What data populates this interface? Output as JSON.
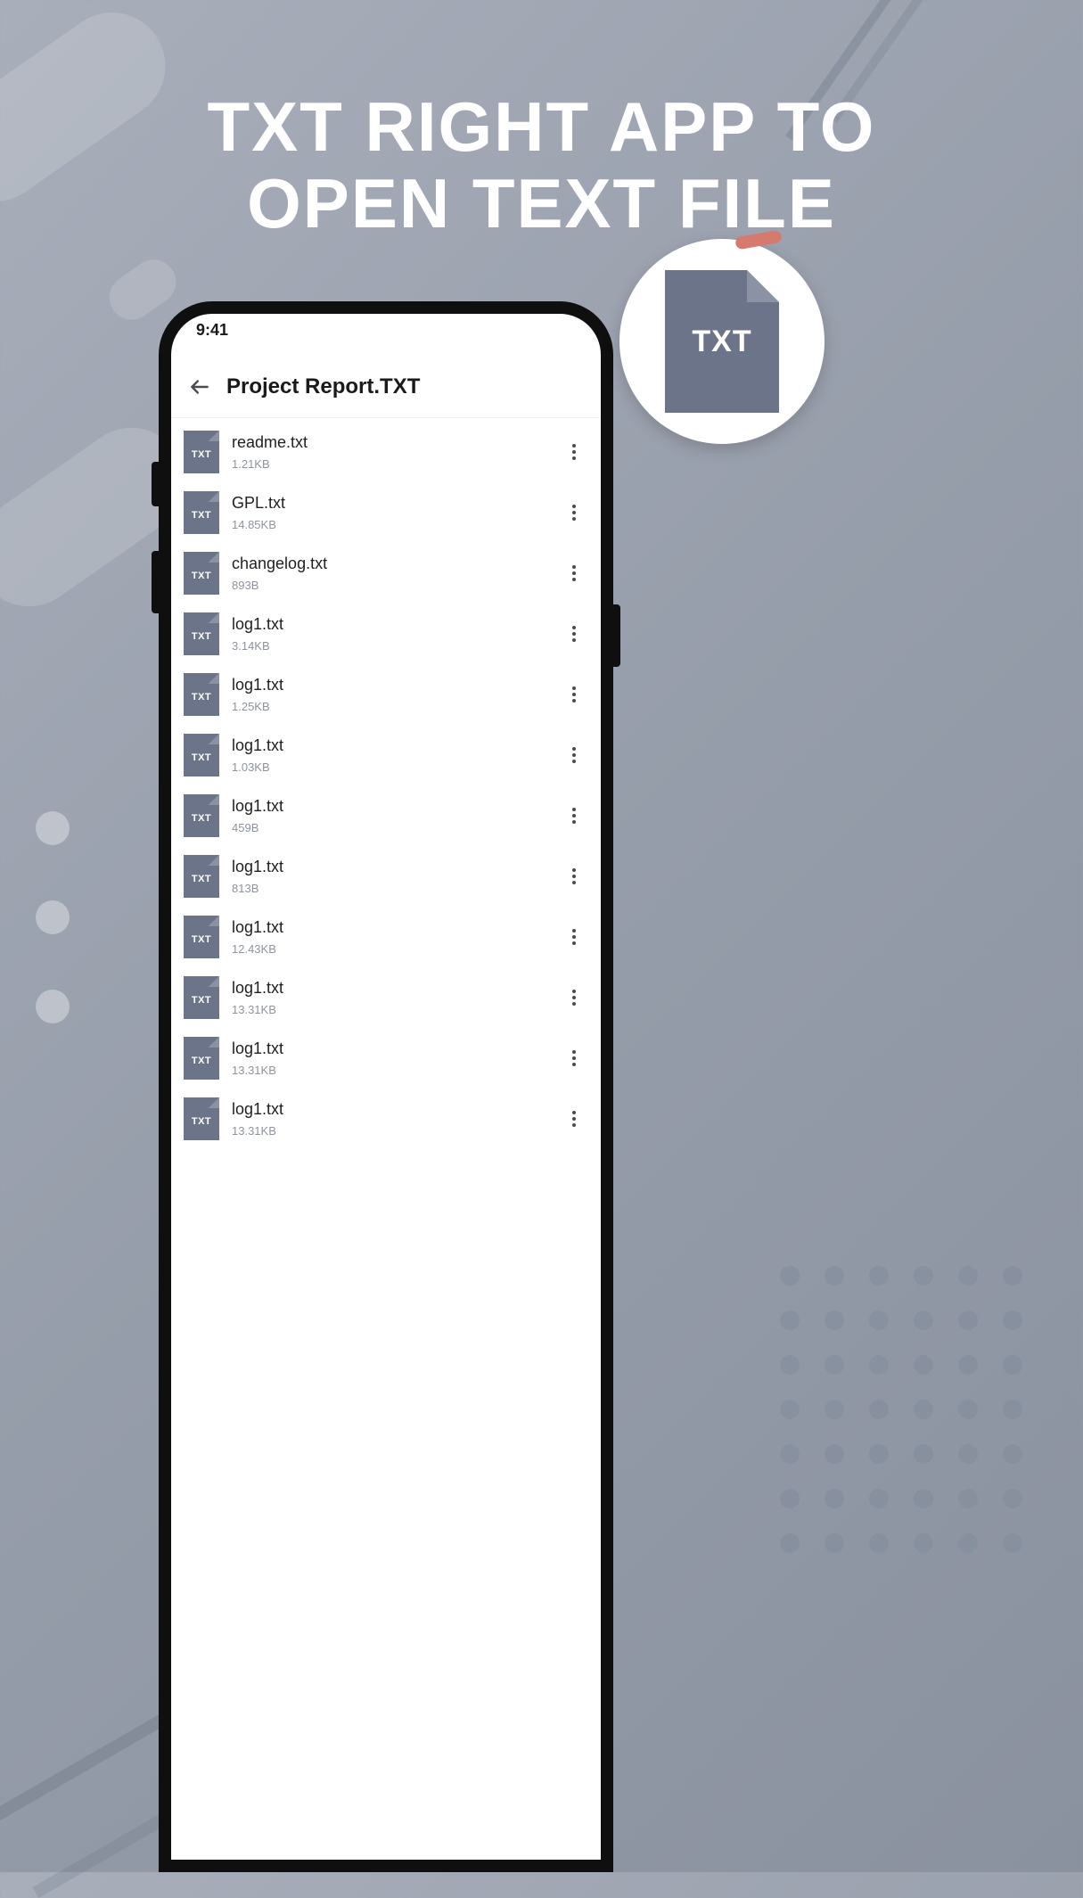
{
  "hero": {
    "line1": "TXT RIGHT APP TO",
    "line2": "OPEN TEXT FILE"
  },
  "statusBar": {
    "time": "9:41"
  },
  "header": {
    "title": "Project Report.TXT"
  },
  "badge": {
    "label": "TXT"
  },
  "fileIconLabel": "TXT",
  "files": [
    {
      "name": "readme.txt",
      "size": "1.21KB"
    },
    {
      "name": "GPL.txt",
      "size": "14.85KB"
    },
    {
      "name": "changelog.txt",
      "size": "893B"
    },
    {
      "name": "log1.txt",
      "size": "3.14KB"
    },
    {
      "name": "log1.txt",
      "size": "1.25KB"
    },
    {
      "name": "log1.txt",
      "size": "1.03KB"
    },
    {
      "name": "log1.txt",
      "size": "459B"
    },
    {
      "name": "log1.txt",
      "size": "813B"
    },
    {
      "name": "log1.txt",
      "size": "12.43KB"
    },
    {
      "name": "log1.txt",
      "size": "13.31KB"
    },
    {
      "name": "log1.txt",
      "size": "13.31KB"
    },
    {
      "name": "log1.txt",
      "size": "13.31KB"
    }
  ]
}
